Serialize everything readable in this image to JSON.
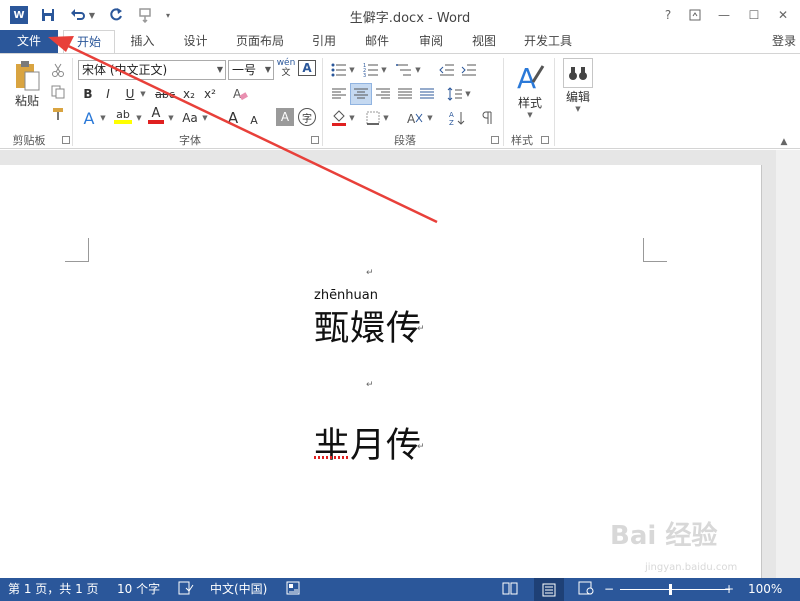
{
  "title_bar": {
    "title": "生僻字.docx - Word",
    "logo_letter": "W",
    "help": "?",
    "minimize": "—",
    "restore": "☐",
    "close": "✕"
  },
  "tabs": {
    "file": "文件",
    "home": "开始",
    "insert": "插入",
    "design": "设计",
    "layout": "页面布局",
    "references": "引用",
    "mailings": "邮件",
    "review": "审阅",
    "view": "视图",
    "developer": "开发工具",
    "login": "登录"
  },
  "ribbon": {
    "clipboard": {
      "paste": "粘贴",
      "label": "剪贴板"
    },
    "font": {
      "font_name": "宋体 (中文正文)",
      "font_size": "一号",
      "phonetic_top": "wén",
      "phonetic_bottom": "文",
      "boxed_char": "A",
      "bold": "B",
      "italic": "I",
      "underline": "U",
      "strike": "abc",
      "subscript": "x₂",
      "superscript": "x²",
      "clear": "A",
      "text_effect": "A",
      "highlight": "ab",
      "font_color": "A",
      "change_case": "Aa",
      "grow": "A",
      "shrink": "A",
      "shading": "A",
      "enclose": "字",
      "label": "字体"
    },
    "paragraph": {
      "label": "段落"
    },
    "styles": {
      "label": "样式",
      "button": "样式"
    },
    "editing": {
      "button": "编辑"
    }
  },
  "document": {
    "line1_pinyin": "zhēnhuan",
    "line1_text": "甄嬛传",
    "line2_text": "芈月传",
    "paragraph_mark": "↵"
  },
  "status_bar": {
    "page": "第 1 页，共 1 页",
    "words": "10 个字",
    "language": "中文(中国)",
    "zoom": "100%",
    "zoom_minus": "−",
    "zoom_plus": "+"
  },
  "watermark": {
    "text": "Bai 经验",
    "sub": "jingyan.baidu.com"
  },
  "colors": {
    "accent": "#2b579a",
    "arrow": "#e8403a",
    "highlight_yellow": "#ffff00",
    "font_red": "#e02020"
  }
}
